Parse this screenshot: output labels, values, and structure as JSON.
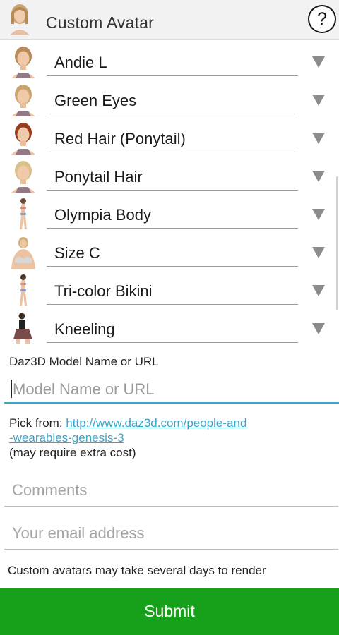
{
  "header": {
    "title": "Custom Avatar",
    "help_label": "?",
    "avatar_icon": "woman-avatar-icon"
  },
  "options": [
    {
      "label": "Andie L",
      "thumb": "face-icon",
      "hair": "#b98a5a"
    },
    {
      "label": "Green Eyes",
      "thumb": "face-icon",
      "hair": "#c9a46c"
    },
    {
      "label": "Red Hair (Ponytail)",
      "thumb": "face-icon",
      "hair": "#9a3d1e"
    },
    {
      "label": "Ponytail Hair",
      "thumb": "face-icon",
      "hair": "#d9c08a"
    },
    {
      "label": "Olympia Body",
      "thumb": "body-icon",
      "hair": "#6a4a36"
    },
    {
      "label": "Size C",
      "thumb": "torso-icon",
      "hair": "#cfae78"
    },
    {
      "label": "Tri-color Bikini",
      "thumb": "body-icon",
      "hair": "#4a3528"
    },
    {
      "label": "Kneeling",
      "thumb": "kneeling-figure-icon",
      "hair": "#3b2c22"
    }
  ],
  "model": {
    "label": "Daz3D Model Name or URL",
    "placeholder": "Model Name or URL",
    "value": ""
  },
  "pick": {
    "prefix": "Pick from: ",
    "link_line1": "http://www.daz3d.com/people-and",
    "link_line2": "-wearables-genesis-3",
    "note": "(may require extra cost)"
  },
  "comments": {
    "placeholder": "Comments",
    "value": ""
  },
  "email": {
    "placeholder": "Your email address",
    "value": ""
  },
  "notice": "Custom avatars may take several days to render",
  "submit_label": "Submit",
  "colors": {
    "accent": "#3aa5c7",
    "submit_bg": "#17a01a",
    "header_bg": "#f2f2f2"
  }
}
